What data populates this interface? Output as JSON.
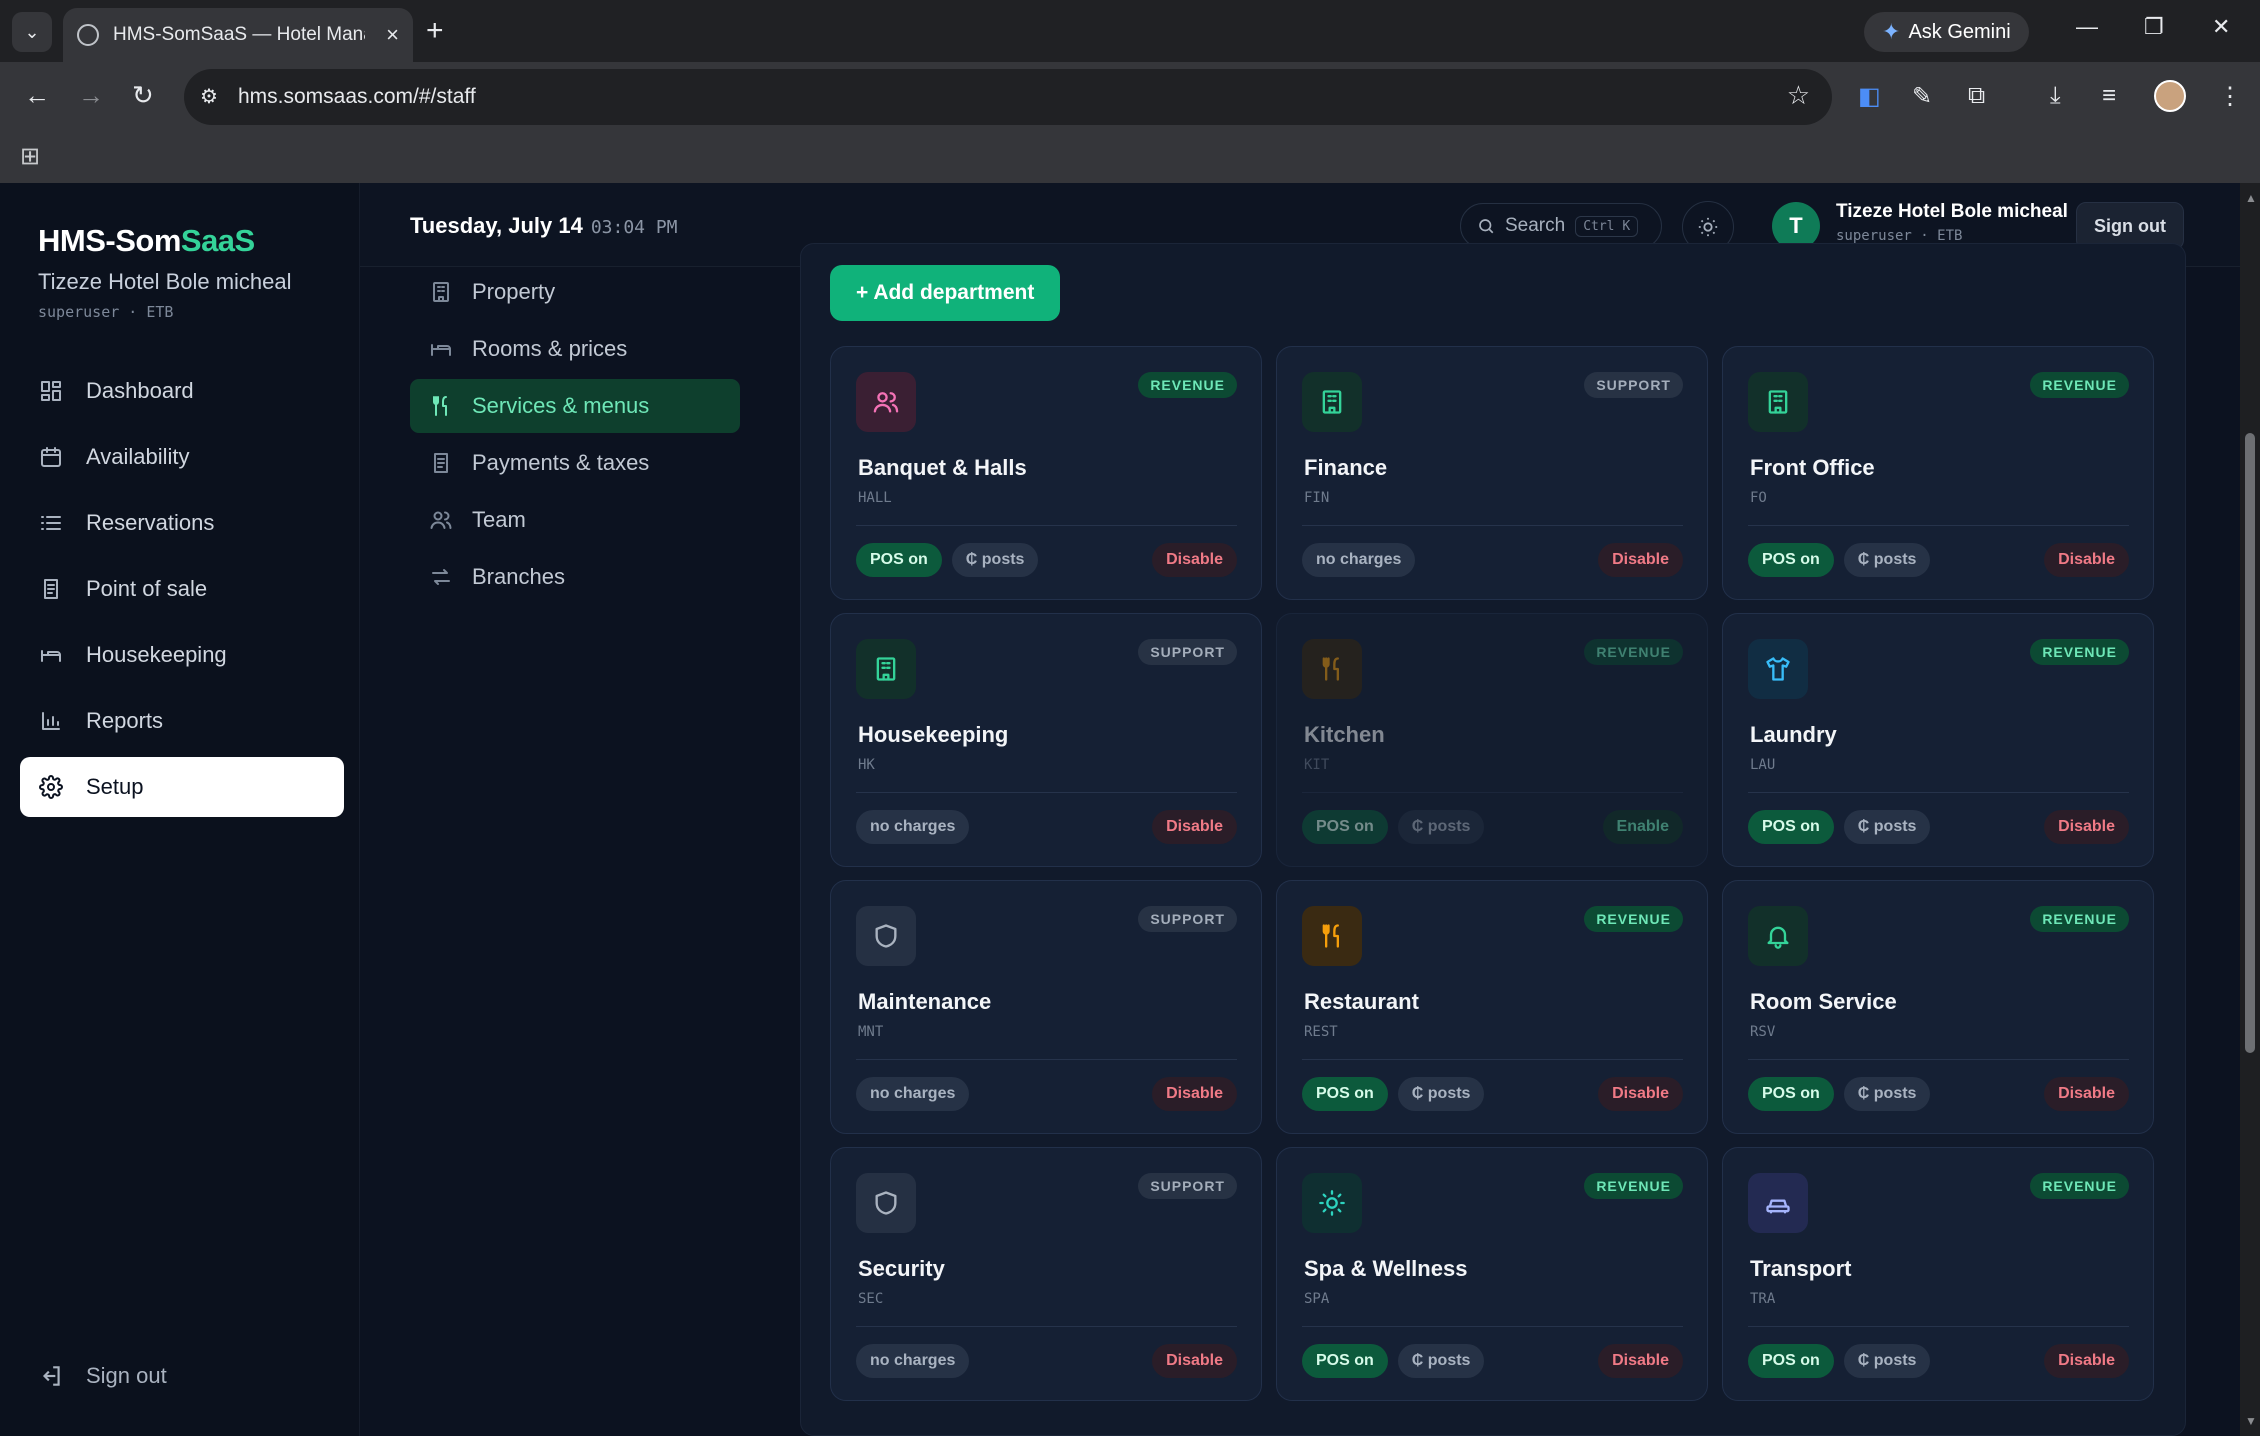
{
  "browser": {
    "tab_title": "HMS-SomSaaS — Hotel Manag",
    "url": "hms.somsaas.com/#/staff",
    "gemini_label": "Ask Gemini"
  },
  "brand": {
    "prefix": "HMS-Som",
    "accent": "SaaS",
    "accent_color": "#34d399"
  },
  "hotel": {
    "name": "Tizeze Hotel Bole micheal",
    "role": "superuser · ETB"
  },
  "nav": [
    {
      "label": "Dashboard",
      "icon": "dashboard-icon"
    },
    {
      "label": "Availability",
      "icon": "calendar-icon"
    },
    {
      "label": "Reservations",
      "icon": "list-icon"
    },
    {
      "label": "Point of sale",
      "icon": "receipt-icon"
    },
    {
      "label": "Housekeeping",
      "icon": "bed-icon"
    },
    {
      "label": "Reports",
      "icon": "bar-chart-icon"
    },
    {
      "label": "Setup",
      "icon": "gear-icon",
      "active": true
    }
  ],
  "sidebar_signout": "Sign out",
  "topbar": {
    "date": "Tuesday, July 14",
    "time": "03:04 PM",
    "search_placeholder": "Search",
    "search_shortcut": "Ctrl K",
    "user_initial": "T",
    "user_name": "Tizeze Hotel Bole micheal",
    "user_role": "superuser · ETB",
    "signout": "Sign out"
  },
  "setup_nav": [
    {
      "label": "Property",
      "icon": "building-icon"
    },
    {
      "label": "Rooms & prices",
      "icon": "bed-icon"
    },
    {
      "label": "Services & menus",
      "icon": "utensils-icon",
      "active": true
    },
    {
      "label": "Payments & taxes",
      "icon": "receipt-icon"
    },
    {
      "label": "Team",
      "icon": "users-icon"
    },
    {
      "label": "Branches",
      "icon": "swap-icon"
    }
  ],
  "add_department": "+ Add department",
  "departments": [
    {
      "name": "Banquet & Halls",
      "code": "HALL",
      "type": "REVENUE",
      "icon": "users-icon",
      "icon_color": "#f472b6",
      "icon_bg": "#3a1f33",
      "pills": [
        "POS on",
        "₵ posts"
      ],
      "action": "Disable"
    },
    {
      "name": "Finance",
      "code": "FIN",
      "type": "SUPPORT",
      "icon": "building-icon",
      "icon_color": "#34d399",
      "icon_bg": "#12302a",
      "pills": [
        "no charges"
      ],
      "action": "Disable"
    },
    {
      "name": "Front Office",
      "code": "FO",
      "type": "REVENUE",
      "icon": "building-icon",
      "icon_color": "#34d399",
      "icon_bg": "#12302a",
      "pills": [
        "POS on",
        "₵ posts"
      ],
      "action": "Disable"
    },
    {
      "name": "Housekeeping",
      "code": "HK",
      "type": "SUPPORT",
      "icon": "building-icon",
      "icon_color": "#34d399",
      "icon_bg": "#12302a",
      "pills": [
        "no charges"
      ],
      "action": "Disable"
    },
    {
      "name": "Kitchen",
      "code": "KIT",
      "type": "REVENUE",
      "icon": "utensils-icon",
      "icon_color": "#f59e0b",
      "icon_bg": "#3a2a12",
      "pills": [
        "POS on",
        "₵ posts"
      ],
      "action": "Enable",
      "disabled": true
    },
    {
      "name": "Laundry",
      "code": "LAU",
      "type": "REVENUE",
      "icon": "shirt-icon",
      "icon_color": "#38bdf8",
      "icon_bg": "#112d43",
      "pills": [
        "POS on",
        "₵ posts"
      ],
      "action": "Disable"
    },
    {
      "name": "Maintenance",
      "code": "MNT",
      "type": "SUPPORT",
      "icon": "shield-icon",
      "icon_color": "#aab3c0",
      "icon_bg": "#253043",
      "pills": [
        "no charges"
      ],
      "action": "Disable"
    },
    {
      "name": "Restaurant",
      "code": "REST",
      "type": "REVENUE",
      "icon": "utensils-icon",
      "icon_color": "#f59e0b",
      "icon_bg": "#3a2a12",
      "pills": [
        "POS on",
        "₵ posts"
      ],
      "action": "Disable"
    },
    {
      "name": "Room Service",
      "code": "RSV",
      "type": "REVENUE",
      "icon": "bell-icon",
      "icon_color": "#34d399",
      "icon_bg": "#12302a",
      "pills": [
        "POS on",
        "₵ posts"
      ],
      "action": "Disable"
    },
    {
      "name": "Security",
      "code": "SEC",
      "type": "SUPPORT",
      "icon": "shield-icon",
      "icon_color": "#aab3c0",
      "icon_bg": "#253043",
      "pills": [
        "no charges"
      ],
      "action": "Disable"
    },
    {
      "name": "Spa & Wellness",
      "code": "SPA",
      "type": "REVENUE",
      "icon": "sun-icon",
      "icon_color": "#2dd4bf",
      "icon_bg": "#0f2f31",
      "pills": [
        "POS on",
        "₵ posts"
      ],
      "action": "Disable"
    },
    {
      "name": "Transport",
      "code": "TRA",
      "type": "REVENUE",
      "icon": "car-icon",
      "icon_color": "#a5b4fc",
      "icon_bg": "#232a52",
      "pills": [
        "POS on",
        "₵ posts"
      ],
      "action": "Disable"
    }
  ]
}
